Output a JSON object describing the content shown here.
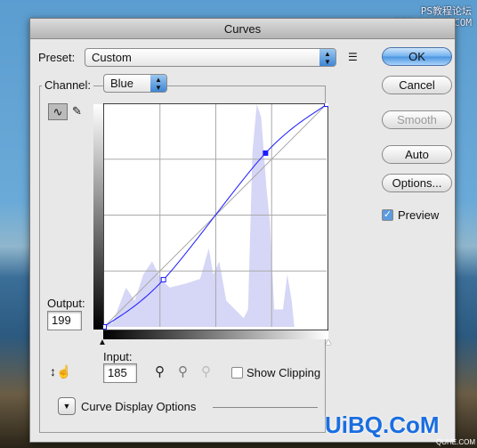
{
  "watermark": {
    "top_line1": "PS教程论坛",
    "top_line2": "BBS.16XX8.COM",
    "bottom": "UiBQ.CoM",
    "bottom_small": "QUHE.COM"
  },
  "dialog": {
    "title": "Curves"
  },
  "preset": {
    "label": "Preset:",
    "value": "Custom"
  },
  "channel": {
    "label": "Channel:",
    "value": "Blue"
  },
  "buttons": {
    "ok": "OK",
    "cancel": "Cancel",
    "smooth": "Smooth",
    "auto": "Auto",
    "options": "Options..."
  },
  "preview": {
    "label": "Preview",
    "checked": true
  },
  "output": {
    "label": "Output:",
    "value": "199"
  },
  "input": {
    "label": "Input:",
    "value": "185"
  },
  "show_clipping": {
    "label": "Show Clipping",
    "checked": false
  },
  "curve_display_options": {
    "label": "Curve Display Options"
  },
  "curve": {
    "channel_color": "#1a1aff",
    "points": [
      [
        0,
        0
      ],
      [
        68,
        54
      ],
      [
        185,
        199
      ],
      [
        255,
        255
      ]
    ],
    "selected_point": [
      185,
      199
    ]
  },
  "histogram_color": "#d6d6f6"
}
